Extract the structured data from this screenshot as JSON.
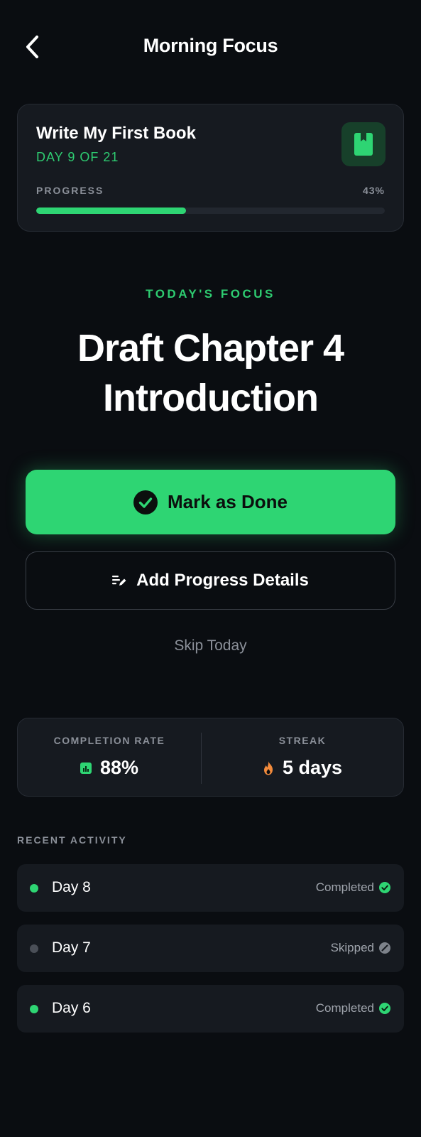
{
  "header": {
    "title": "Morning Focus",
    "back_icon": "chevron-left-icon"
  },
  "goal": {
    "title": "Write My First Book",
    "day_text": "DAY 9 OF 21",
    "icon": "book-icon",
    "progress_label": "PROGRESS",
    "progress_text": "43%",
    "progress_value": 0.43
  },
  "focus": {
    "eyebrow": "TODAY'S FOCUS",
    "title": "Draft Chapter 4 Introduction"
  },
  "actions": {
    "done_label": "Mark as Done",
    "details_label": "Add Progress Details",
    "skip_label": "Skip Today"
  },
  "stats": {
    "completion_label": "COMPLETION RATE",
    "completion_value": "88%",
    "streak_label": "STREAK",
    "streak_value": "5 days"
  },
  "recent": {
    "heading": "RECENT ACTIVITY",
    "items": [
      {
        "day": "Day 8",
        "status": "Completed",
        "state": "completed"
      },
      {
        "day": "Day 7",
        "status": "Skipped",
        "state": "skipped"
      },
      {
        "day": "Day 6",
        "status": "Completed",
        "state": "completed"
      }
    ]
  },
  "colors": {
    "background": "#0a0d11",
    "card": "#161a20",
    "accent": "#2ed573",
    "muted": "#8b9099",
    "streak": "#f28b3c"
  }
}
